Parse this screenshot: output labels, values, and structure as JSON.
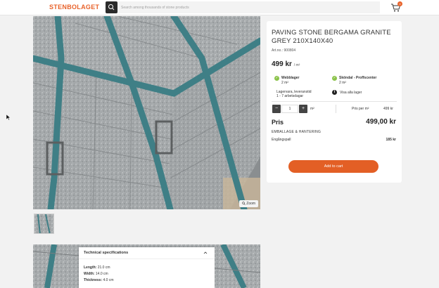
{
  "header": {
    "logo": "STENBOLAGET",
    "search_placeholder": "Search among thousands of stone products",
    "cart_count": "0"
  },
  "gallery": {
    "zoom_label": "Zoom"
  },
  "product": {
    "title": "PAVING STONE BERGAMA GRANITE GREY 210X140X40",
    "article_no": "Art.no.: 900804",
    "price": "499 kr",
    "price_unit": "/ m²",
    "stock": [
      {
        "name": "Webblager",
        "qty": "2 m²"
      },
      {
        "name": "Sköndal - Proffscenter",
        "qty": "2 m²"
      }
    ],
    "delivery_line1": "Lagervara, leveranstid",
    "delivery_line2": "1 - 7 arbetsdagar",
    "show_all_stock": "Visa alla lager",
    "quantity": "1",
    "quantity_unit": "m²",
    "price_per_label": "Pris per m²",
    "price_per_value": "499 kr",
    "total_label": "Pris",
    "total_value": "499,00 kr",
    "handling_label": "EMBALLAGE & HANTERING",
    "pallet_label": "Engångspall",
    "pallet_value": "185 kr",
    "add_to_cart": "Add to cart"
  },
  "tech_specs": {
    "title": "Technical specifications",
    "rows": [
      {
        "label": "Length:",
        "value": "21.0 cm"
      },
      {
        "label": "Width:",
        "value": "14.0 cm"
      },
      {
        "label": "Thickness:",
        "value": "4.0 cm"
      }
    ]
  },
  "colors": {
    "brand": "#e8622a",
    "button": "#e35f25",
    "in_stock": "#8bc34a",
    "strap": "#3f7f86"
  },
  "icons": [
    "search-icon",
    "cart-icon",
    "zoom-icon",
    "check-icon",
    "info-icon",
    "minus-icon",
    "plus-icon",
    "chevron-up-icon",
    "cursor-icon"
  ]
}
